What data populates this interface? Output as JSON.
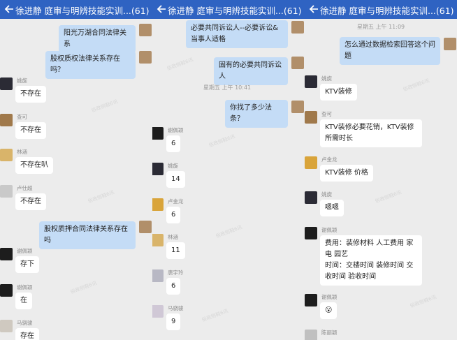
{
  "header": {
    "title": "徐进静 庭审与明辨技能实训...(61)"
  },
  "colors": {
    "header": "#2f63c2",
    "bubble_out": "#c4dcf6",
    "bubble_in": "#ffffff",
    "background": "#ececec"
  },
  "icons": {
    "back": "back-arrow-icon",
    "mute": "mute-icon"
  },
  "panel1": {
    "messages": [
      {
        "text": "阳光万湖合同法律关系"
      },
      {
        "text": "股权质权法律关系存在吗？"
      },
      {
        "sender": "姚旋",
        "text": "不存在"
      },
      {
        "sender": "查可",
        "text": "不存在"
      },
      {
        "sender": "林涵",
        "text": "不存在叭"
      },
      {
        "sender": "卢仕超",
        "text": "不存在"
      },
      {
        "text": "股权质押合同法律关系存在吗"
      },
      {
        "sender": "谢佩颖",
        "text": "存下"
      },
      {
        "sender": "谢佩颖",
        "text": "在"
      },
      {
        "sender": "马骁骏",
        "text": "存在"
      }
    ]
  },
  "panel2": {
    "messages": [
      {
        "text": "必要共同诉讼人--必要诉讼&当事人适格"
      },
      {
        "text": "固有的必要共同诉讼人"
      },
      {
        "time": "星期五 上午 10:41"
      },
      {
        "text": "你找了多少法条？"
      },
      {
        "sender": "谢佩颖",
        "text": "6"
      },
      {
        "sender": "姚旋",
        "text": "14"
      },
      {
        "sender": "卢金龙",
        "text": "6"
      },
      {
        "sender": "林涵",
        "text": "11"
      },
      {
        "sender": "唐宇玲",
        "text": "6"
      },
      {
        "sender": "马骁骏",
        "text": "9"
      }
    ]
  },
  "panel3": {
    "messages": [
      {
        "time": "星期五 上午 11:09"
      },
      {
        "text": "怎么通过数据检索回答这个问题"
      },
      {
        "sender": "姚旋",
        "text": "KTV装修"
      },
      {
        "sender": "查可",
        "text": "KTV装修必要花销，KTV装修所需时长"
      },
      {
        "sender": "卢金龙",
        "text": "KTV装修 价格"
      },
      {
        "sender": "姚旋",
        "text": "嗯嗯"
      },
      {
        "sender": "谢佩颖",
        "text": "费用：装修材料 人工费用 家电 园艺\n时间：交楼时间 装修时间 交收时间 验收时间"
      },
      {
        "sender": "谢佩颖",
        "text": "😮"
      },
      {
        "sender": "陈丽颖",
        "text": ""
      }
    ]
  }
}
